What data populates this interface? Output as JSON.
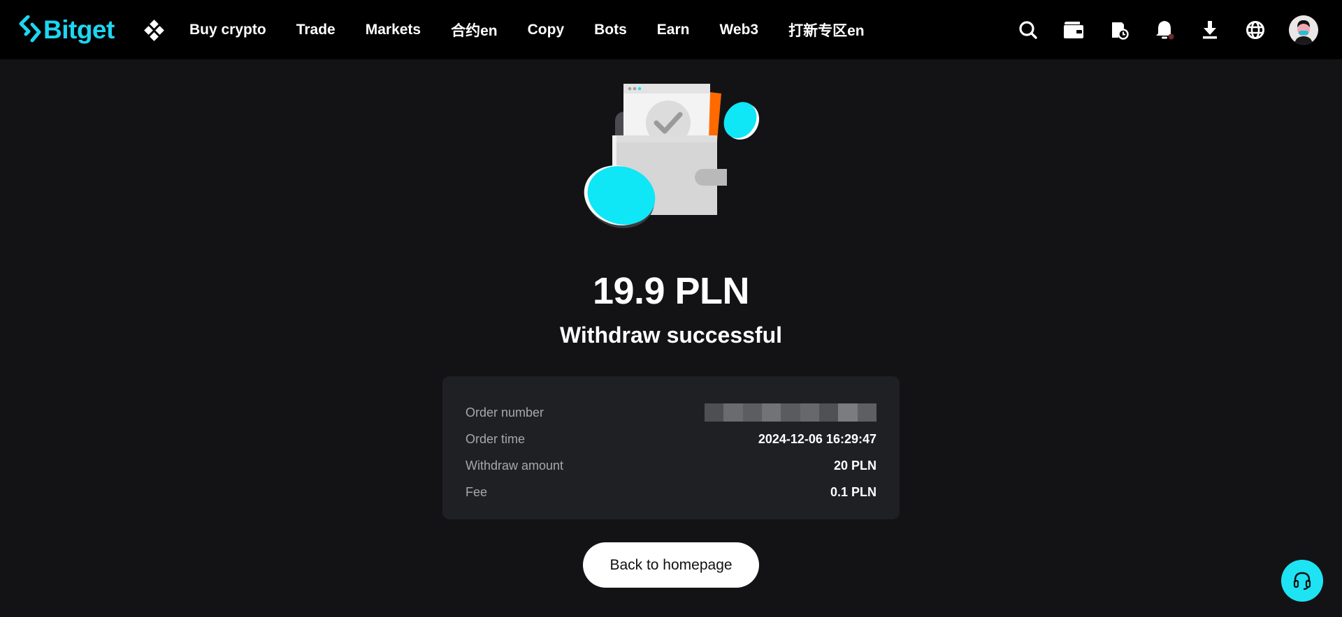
{
  "brand": {
    "name": "Bitget",
    "accent": "#1dd6f2"
  },
  "nav": {
    "items": [
      {
        "label": "Buy crypto"
      },
      {
        "label": "Trade"
      },
      {
        "label": "Markets"
      },
      {
        "label": "合约en"
      },
      {
        "label": "Copy"
      },
      {
        "label": "Bots"
      },
      {
        "label": "Earn"
      },
      {
        "label": "Web3"
      },
      {
        "label": "打新专区en"
      }
    ]
  },
  "toolbar_icons": [
    "search-icon",
    "wallet-icon",
    "order-history-icon",
    "bell-icon",
    "download-icon",
    "globe-icon",
    "avatar"
  ],
  "result": {
    "amount": "19.9 PLN",
    "status": "Withdraw successful"
  },
  "details": {
    "order_number": {
      "label": "Order number",
      "value_hidden": true
    },
    "order_time": {
      "label": "Order time",
      "value": "2024-12-06 16:29:47"
    },
    "withdraw_amount": {
      "label": "Withdraw amount",
      "value": "20 PLN"
    },
    "fee": {
      "label": "Fee",
      "value": "0.1 PLN"
    }
  },
  "actions": {
    "back_label": "Back to homepage"
  },
  "colors": {
    "background": "#131316",
    "card": "#1f2024",
    "support": "#1ee3f2"
  }
}
